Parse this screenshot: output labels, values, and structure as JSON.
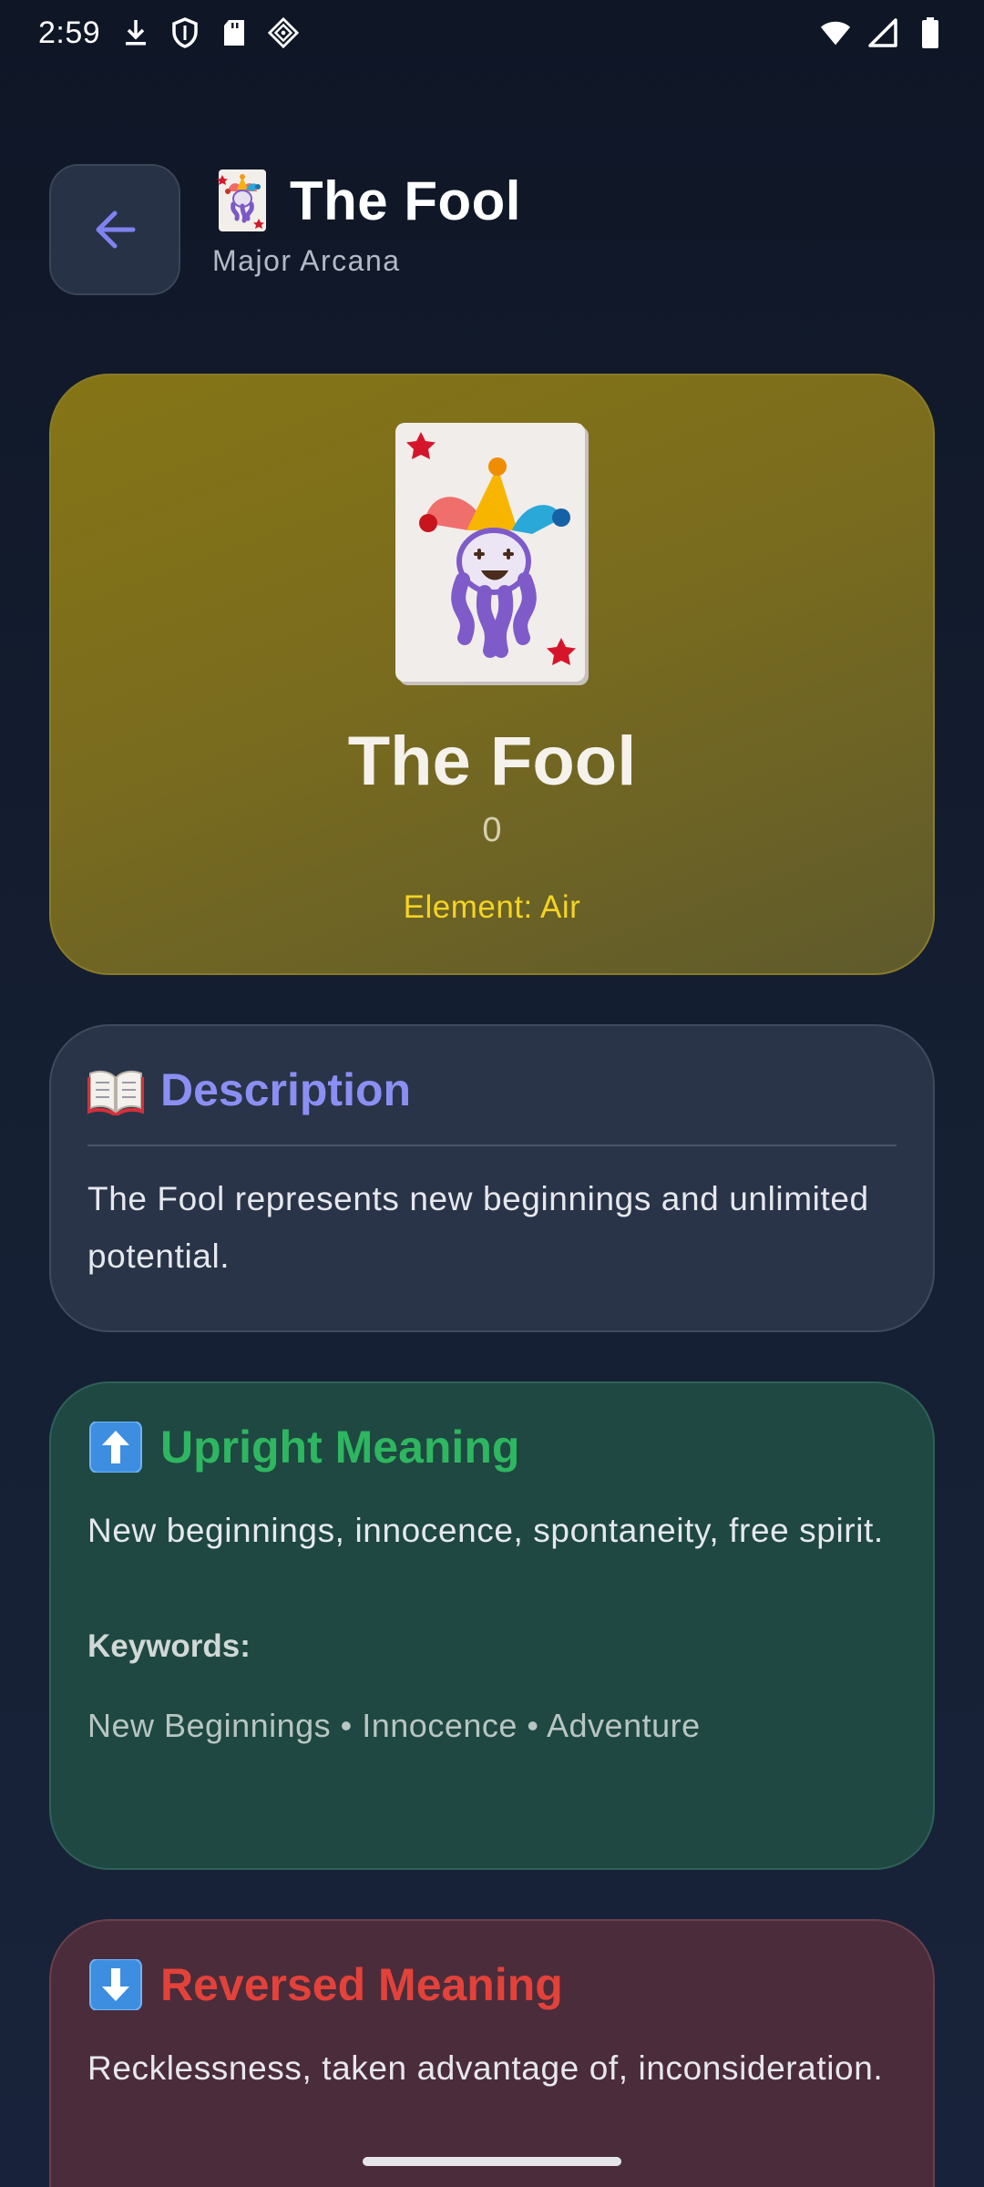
{
  "status_bar": {
    "time": "2:59",
    "left_icons": [
      "download-icon",
      "shield-icon",
      "sd-card-icon",
      "diamond-app-icon"
    ],
    "right_icons": [
      "wifi-icon",
      "cell-signal-icon",
      "battery-icon"
    ]
  },
  "header": {
    "back_icon": "arrow-left-icon",
    "title": "The Fool",
    "subtitle": "Major Arcana"
  },
  "hero": {
    "card_art_icon": "joker-card-icon",
    "title": "The Fool",
    "number": "0",
    "element": "Element: Air"
  },
  "description": {
    "icon": "open-book-icon",
    "title": "Description",
    "text": "The Fool represents new beginnings and unlimited potential."
  },
  "upright": {
    "icon": "up-arrow-icon",
    "title": "Upright Meaning",
    "text": "New beginnings, innocence, spontaneity, free spirit.",
    "keywords_label": "Keywords:",
    "keywords": "New Beginnings • Innocence • Adventure"
  },
  "reversed": {
    "icon": "down-arrow-icon",
    "title": "Reversed Meaning",
    "text": "Recklessness, taken advantage of, inconsideration."
  },
  "colors": {
    "background": "#141b2d",
    "hero_card": "#7a6c1e",
    "element_text": "#f5d423",
    "description_accent": "#8b8ff3",
    "upright_accent": "#2eb660",
    "reversed_accent": "#e2423a"
  }
}
